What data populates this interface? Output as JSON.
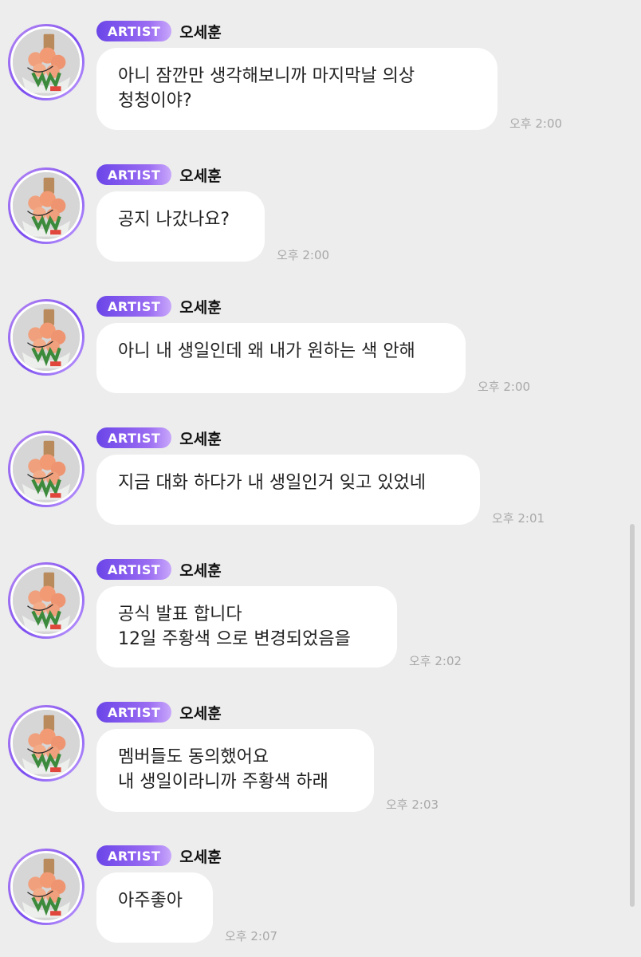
{
  "badge_label": "ARTIST",
  "sender_name": "오세훈",
  "colors": {
    "background": "#ededed",
    "bubble": "#ffffff",
    "badge_start": "#6b45e8",
    "badge_end": "#c9a8fb",
    "timestamp": "#a8a8a8"
  },
  "messages": [
    {
      "text": "아니 잠깐만 생각해보니까  마지막날 의상\n청청이야?",
      "time": "오후 2:00"
    },
    {
      "text": "공지 나갔나요?",
      "time": "오후 2:00"
    },
    {
      "text": "아니 내 생일인데 왜 내가 원하는 색 안해",
      "time": "오후 2:00"
    },
    {
      "text": "지금 대화 하다가 내 생일인거 잊고 있었네",
      "time": "오후 2:01"
    },
    {
      "text": "공식 발표 합니다\n12일 주황색 으로 변경되었음을",
      "time": "오후 2:02"
    },
    {
      "text": "멤버들도 동의했어요\n내 생일이라니까 주황색 하래",
      "time": "오후 2:03"
    },
    {
      "text": "아주좋아",
      "time": "오후 2:07"
    }
  ]
}
